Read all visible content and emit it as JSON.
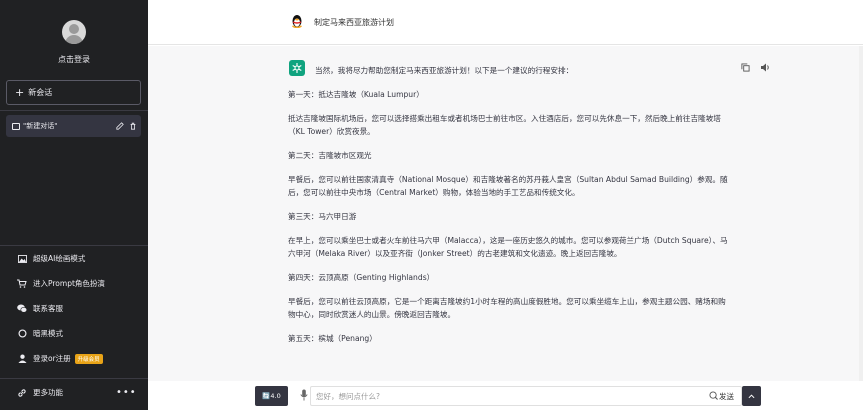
{
  "sidebar": {
    "login_label": "点击登录",
    "new_chat_label": "新会话",
    "chat_items": [
      {
        "label": "\"新建对话\""
      }
    ],
    "menu": [
      {
        "label": "超级AI绘画模式",
        "icon": "image-icon"
      },
      {
        "label": "进入Prompt角色扮演",
        "icon": "cart-icon"
      },
      {
        "label": "联系客服",
        "icon": "wechat-icon"
      },
      {
        "label": "暗黑模式",
        "icon": "circle-icon"
      },
      {
        "label": "登录or注册",
        "icon": "user-icon",
        "badge": "升级会员"
      }
    ],
    "more_label": "更多功能"
  },
  "header": {
    "title": "制定马来西亚旅游计划"
  },
  "message": {
    "lines": [
      "当然，我将尽力帮助您制定马来西亚旅游计划！以下是一个建议的行程安排：",
      "第一天：抵达吉隆坡（Kuala Lumpur）",
      "抵达吉隆坡国际机场后，您可以选择搭乘出租车或者机场巴士前往市区。入住酒店后，您可以先休息一下，然后晚上前往吉隆坡塔（KL Tower）欣赏夜景。",
      "第二天：吉隆坡市区观光",
      "早餐后，您可以前往国家清真寺（National Mosque）和吉隆坡著名的苏丹莪人皇宫（Sultan Abdul Samad Building）参观。随后，您可以前往中央市场（Central Market）购物，体验当地的手工艺品和传统文化。",
      "第三天：马六甲日游",
      "在早上，您可以乘坐巴士或者火车前往马六甲（Malacca），这是一座历史悠久的城市。您可以参观荷兰广场（Dutch Square）、马六甲河（Melaka River）以及亚齐街（Jonker Street）的古老建筑和文化遗迹。晚上返回吉隆坡。",
      "第四天：云顶高原（Genting Highlands）",
      "早餐后，您可以前往云顶高原，它是一个距离吉隆坡约1小时车程的高山度假胜地。您可以乘坐缆车上山，参观主题公园、赌场和购物中心，同时欣赏迷人的山景。傍晚返回吉隆坡。",
      "第五天：槟城（Penang）"
    ]
  },
  "input": {
    "model_label": "🔄4.0",
    "placeholder": "您好，想问点什么?",
    "send_label": "发送"
  },
  "colors": {
    "sidebar_bg": "#202123",
    "accent": "#10a37f",
    "badge": "#e8a317"
  }
}
